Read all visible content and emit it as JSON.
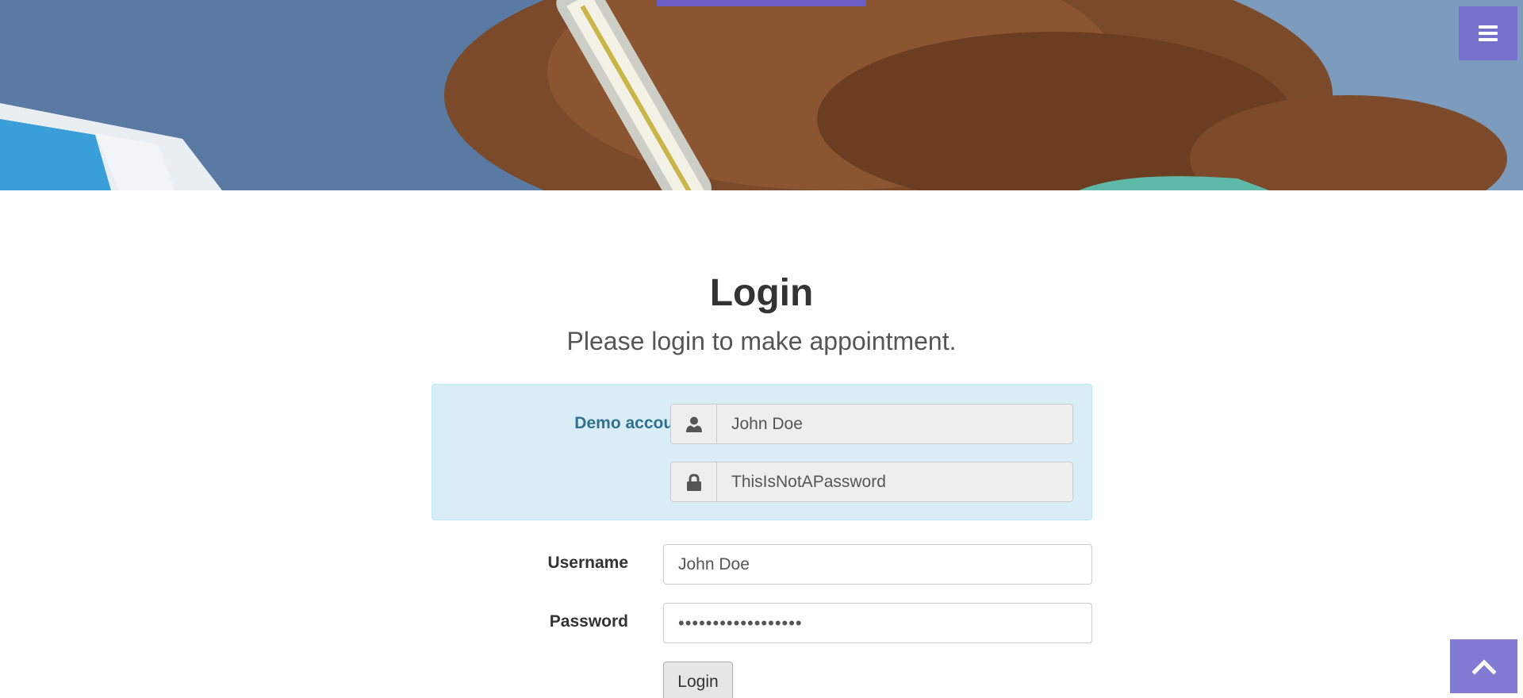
{
  "header": {
    "menu_icon": "bars-icon"
  },
  "login": {
    "title": "Login",
    "subtitle": "Please login to make appointment.",
    "demo": {
      "label": "Demo account",
      "username": "John Doe",
      "password": "ThisIsNotAPassword",
      "user_icon": "user-icon",
      "lock_icon": "lock-icon"
    },
    "form": {
      "username_label": "Username",
      "username_value": "John Doe",
      "password_label": "Password",
      "password_value": "ThisIsNotAPassword",
      "submit_label": "Login"
    }
  },
  "scroll_top_icon": "chevron-up-icon",
  "colors": {
    "accent": "#766dce",
    "demo_bg": "#d9edf7",
    "demo_text": "#31708f"
  }
}
